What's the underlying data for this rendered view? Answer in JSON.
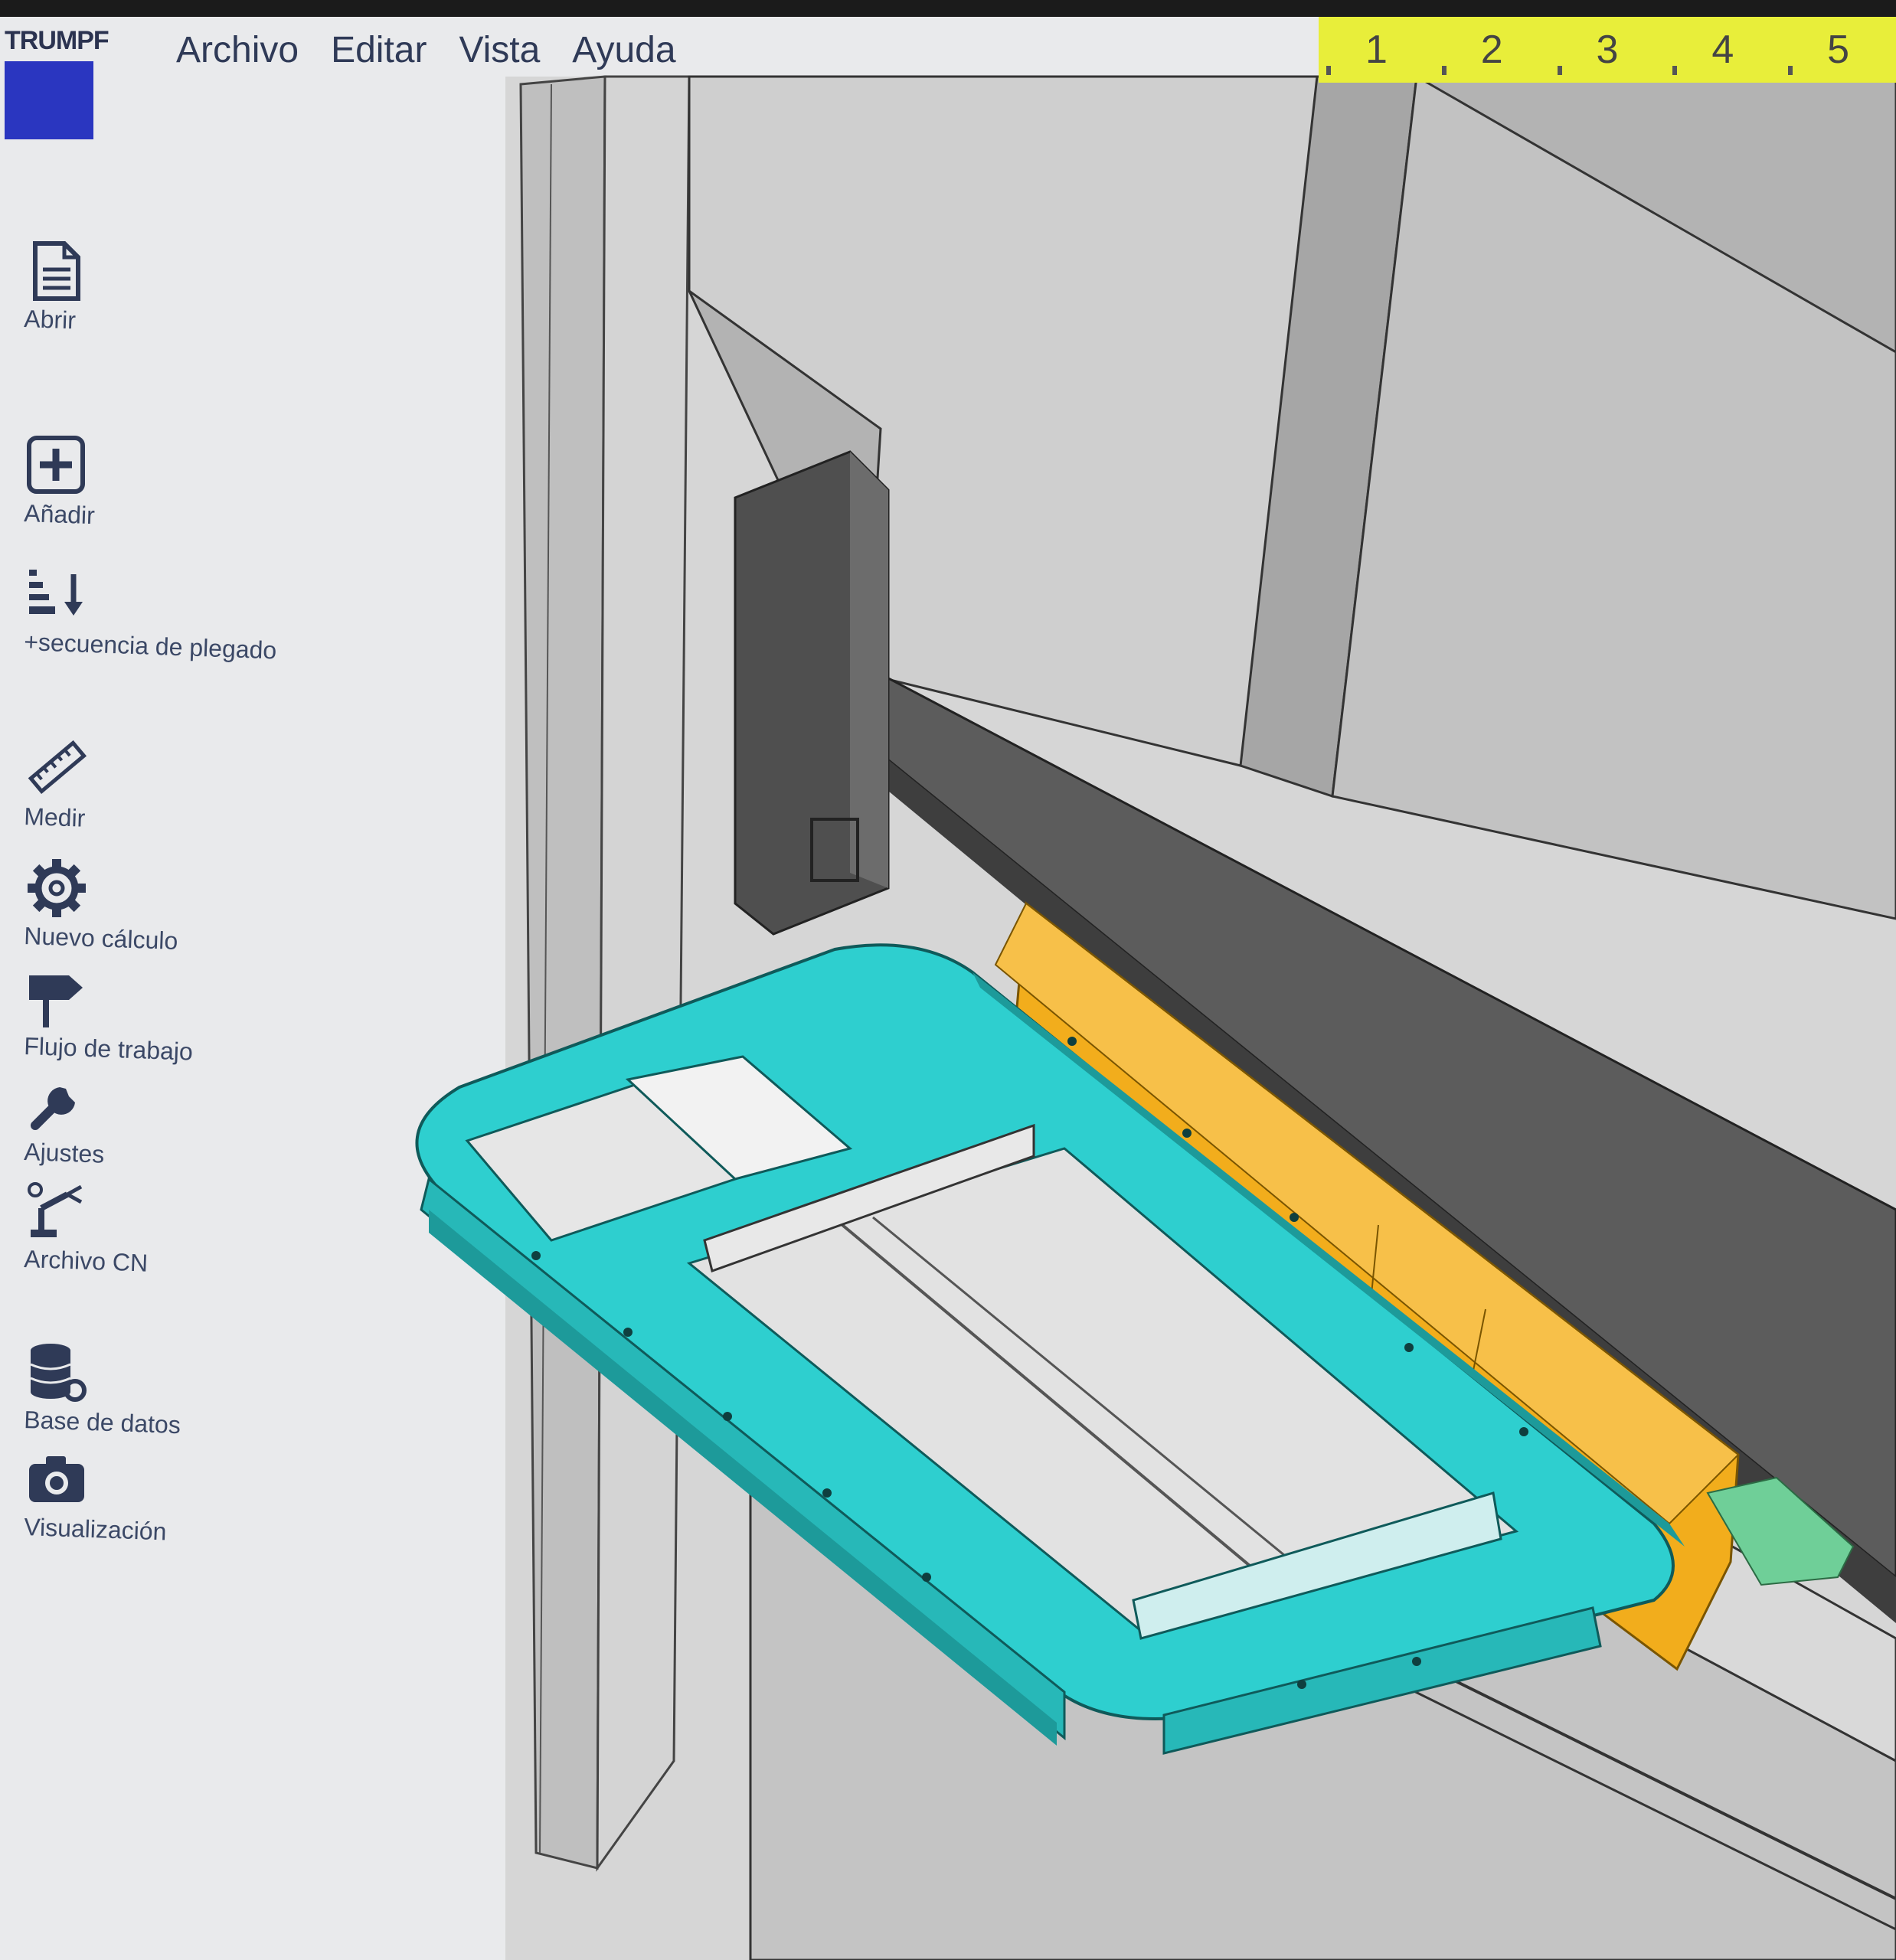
{
  "header": {
    "logo": "TRUMPF",
    "menu": [
      "Archivo",
      "Editar",
      "Vista",
      "Ayuda"
    ]
  },
  "steps": [
    "1",
    "2",
    "3",
    "4",
    "5"
  ],
  "sidebar": {
    "tools": [
      {
        "label": "Abrir",
        "icon": "document-icon"
      },
      {
        "label": "Añadir",
        "icon": "add-icon"
      },
      {
        "label": "+secuencia de plegado",
        "icon": "bend-sequence-icon"
      },
      {
        "label": "Medir",
        "icon": "ruler-icon"
      },
      {
        "label": "Nuevo cálculo",
        "icon": "gear-icon"
      },
      {
        "label": "Flujo de trabajo",
        "icon": "signpost-icon"
      },
      {
        "label": "Ajustes",
        "icon": "wrench-icon"
      },
      {
        "label": "Archivo CN",
        "icon": "robot-arm-icon"
      },
      {
        "label": "Base de datos",
        "icon": "database-icon"
      },
      {
        "label": "Visualización",
        "icon": "camera-icon"
      }
    ]
  },
  "colors": {
    "part": "#2ecfcf",
    "tool": "#f2ad1c",
    "steps_bar": "#e8ee3a",
    "logo_block": "#2a36c0",
    "machine_dark": "#5c5c5c",
    "machine_light": "#c9c9c9"
  }
}
